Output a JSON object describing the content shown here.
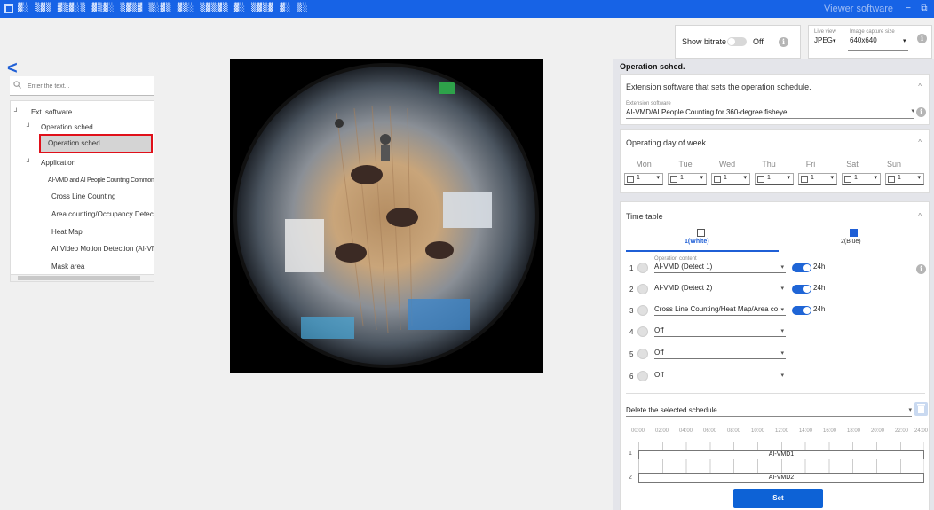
{
  "titlebar": {
    "garbled_title": "▓░ ▒▓▒ ▓▒▓░▒ ▓▒▓░ ▒▓▒▓ ▒░▓▒ ▓▒░ ▒▓▒▓▒ ▓░ ▒▓▒▓ ▓░ ▒░",
    "viewer_label": "Viewer software",
    "minimize": "−",
    "restore": "⧉"
  },
  "bitrate": {
    "label": "Show bitrate",
    "state": "Off"
  },
  "liveview": {
    "label": "Live view",
    "value": "JPEG",
    "capture_label": "Image capture size",
    "capture_value": "640x640"
  },
  "search": {
    "placeholder": "Enter the text..."
  },
  "tree": [
    {
      "label": "Ext. software",
      "toggle": "┘"
    },
    {
      "label": "Operation sched.",
      "toggle": "┘"
    },
    {
      "label": "Operation sched."
    },
    {
      "label": "Application",
      "toggle": "┘"
    },
    {
      "label": "AI-VMD and AI People Counting  Common"
    },
    {
      "label": "Cross Line Counting"
    },
    {
      "label": "Area counting/Occupancy Detecti"
    },
    {
      "label": "Heat Map"
    },
    {
      "label": "AI Video Motion Detection (AI-VN"
    },
    {
      "label": "Mask area"
    }
  ],
  "panel": {
    "title": "Operation sched.",
    "ext": {
      "header": "Extension software that sets the operation schedule.",
      "field_label": "Extension software",
      "field_value": "AI-VMD/AI People Counting for 360-degree fisheye"
    },
    "days": {
      "header": "Operating day of week",
      "names": [
        "Mon",
        "Tue",
        "Wed",
        "Thu",
        "Fri",
        "Sat",
        "Sun"
      ],
      "values": [
        "1",
        "1",
        "1",
        "1",
        "1",
        "1",
        "1"
      ]
    },
    "timetable": {
      "header": "Time table",
      "tab1": "1(White)",
      "tab2": "2(Blue)",
      "op_label": "Operation content",
      "rows": [
        {
          "n": "1",
          "value": "AI-VMD (Detect 1)",
          "on": true,
          "hours": "24h"
        },
        {
          "n": "2",
          "value": "AI-VMD (Detect 2)",
          "on": true,
          "hours": "24h"
        },
        {
          "n": "3",
          "value": "Cross Line Counting/Heat Map/Area co",
          "on": true,
          "hours": "24h"
        },
        {
          "n": "4",
          "value": "Off",
          "on": false,
          "hours": ""
        },
        {
          "n": "5",
          "value": "Off",
          "on": false,
          "hours": ""
        },
        {
          "n": "6",
          "value": "Off",
          "on": false,
          "hours": ""
        }
      ],
      "delete_label": "Delete the selected schedule",
      "times": [
        "00:00",
        "02:00",
        "04:00",
        "06:00",
        "08:00",
        "10:00",
        "12:00",
        "14:00",
        "16:00",
        "18:00",
        "20:00",
        "22:00",
        "24:00"
      ],
      "timeline": [
        {
          "n": "1",
          "label": "AI-VMD1"
        },
        {
          "n": "2",
          "label": "AI-VMD2"
        }
      ]
    }
  },
  "set_button": "Set",
  "colors": {
    "accent": "#0d62d6",
    "titlebar": "#1763e6",
    "highlight": "#e0101a"
  }
}
